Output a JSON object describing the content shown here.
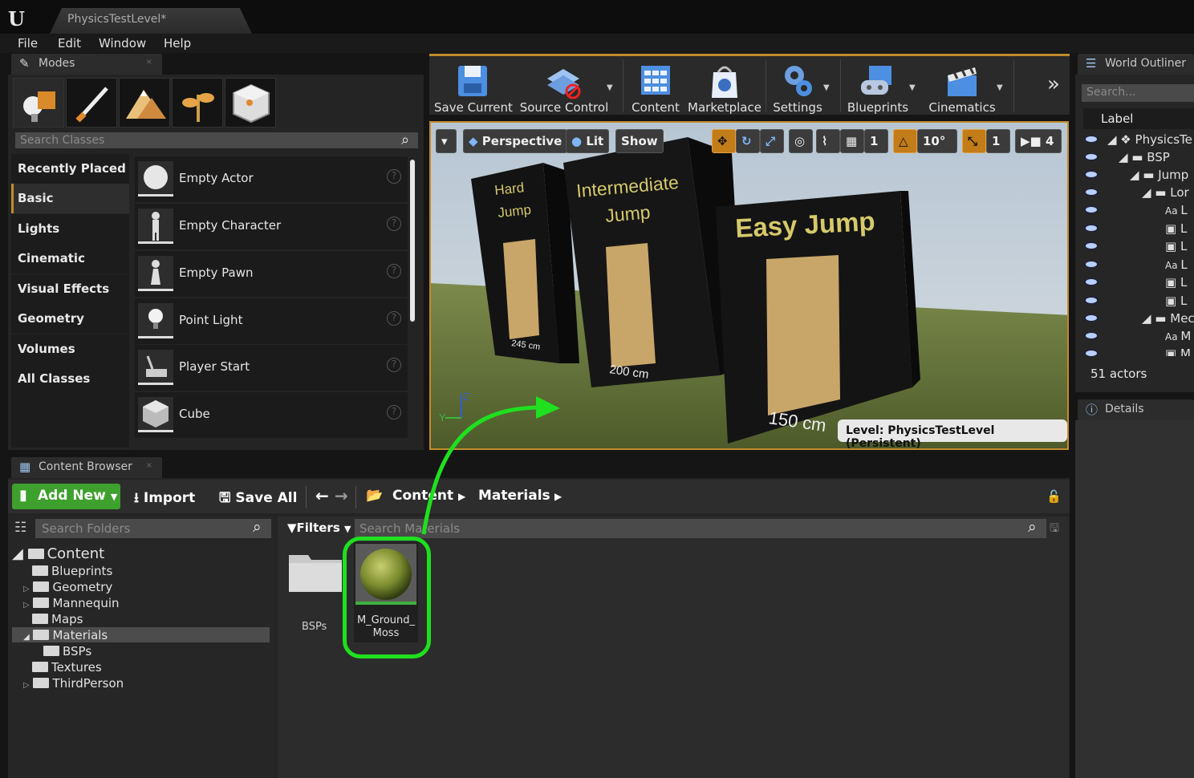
{
  "window": {
    "tab_title": "PhysicsTestLevel*"
  },
  "menu": [
    "File",
    "Edit",
    "Window",
    "Help"
  ],
  "modes": {
    "tab_label": "Modes",
    "search_placeholder": "Search Classes",
    "categories": [
      "Recently Placed",
      "Basic",
      "Lights",
      "Cinematic",
      "Visual Effects",
      "Geometry",
      "Volumes",
      "All Classes"
    ],
    "items": [
      "Empty Actor",
      "Empty Character",
      "Empty Pawn",
      "Point Light",
      "Player Start",
      "Cube"
    ]
  },
  "toolbar": {
    "buttons": [
      "Save Current",
      "Source Control",
      "Content",
      "Marketplace",
      "Settings",
      "Blueprints",
      "Cinematics"
    ]
  },
  "viewport": {
    "perspective": "Perspective",
    "lit": "Lit",
    "show": "Show",
    "grid_snap": "1",
    "rot_snap": "10°",
    "scale_snap": "1",
    "camera_speed": "4",
    "level_label": "Level:  PhysicsTestLevel (Persistent)",
    "signs": [
      "Hard Jump",
      "Intermediate Jump",
      "Easy Jump"
    ],
    "dims": [
      "245 cm",
      "200 cm",
      "150 cm"
    ]
  },
  "outliner": {
    "tab_label": "World Outliner",
    "search_placeholder": "Search...",
    "column": "Label",
    "rows": [
      "PhysicsTe",
      "BSP",
      "Jump",
      "Lor",
      "L",
      "L",
      "L",
      "L",
      "L",
      "L",
      "Mec",
      "M",
      "M"
    ],
    "actor_count": "51 actors"
  },
  "details": {
    "tab_label": "Details"
  },
  "content_browser": {
    "tab_label": "Content Browser",
    "add_new": "Add New",
    "import": "Import",
    "save_all": "Save All",
    "breadcrumb": [
      "Content",
      "Materials"
    ],
    "search_folders_placeholder": "Search Folders",
    "filters": "Filters",
    "search_assets_placeholder": "Search Materials",
    "tree": {
      "root": "Content",
      "children": [
        "Blueprints",
        "Geometry",
        "Mannequin",
        "Maps",
        "Materials",
        "BSPs",
        "Textures",
        "ThirdPerson"
      ]
    },
    "assets": {
      "folder": "BSPs",
      "material_line1": "M_Ground_",
      "material_line2": "Moss"
    }
  },
  "colors": {
    "accent": "#c28b2c",
    "add_new": "#3ea02d",
    "highlight": "#1fe01f"
  }
}
